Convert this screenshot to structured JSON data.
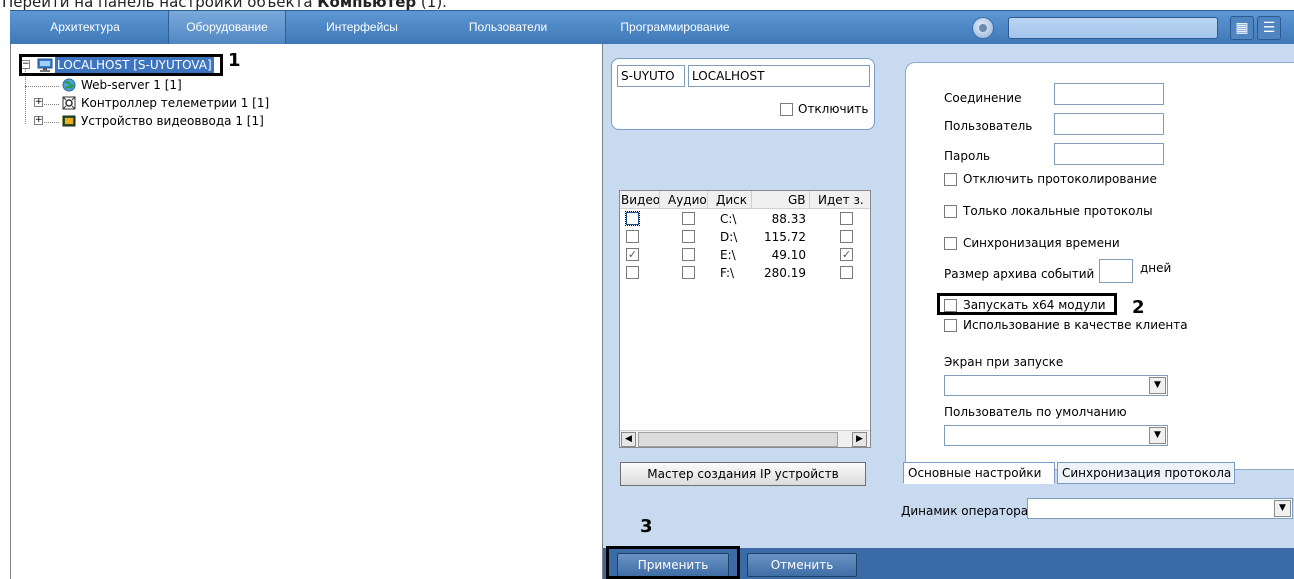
{
  "caption": {
    "text_prefix": "Перейти на панель настройки объекта ",
    "text_bold": "Компьютер",
    "text_suffix": " (1)."
  },
  "menubar": {
    "items": [
      "Архитектура",
      "Оборудование",
      "Интерфейсы",
      "Пользователи",
      "Программирование"
    ],
    "active_index": 1,
    "search_value": "",
    "icons": [
      "search-icon",
      "grid-view-icon",
      "list-view-icon"
    ]
  },
  "tree": {
    "root_label": "LOCALHOST [S-UYUTOVA]",
    "children": [
      {
        "label": "Web-server 1 [1]",
        "icon": "globe-icon"
      },
      {
        "label": "Контроллер телеметрии 1 [1]",
        "icon": "telemetry-icon"
      },
      {
        "label": "Устройство видеоввода 1 [1]",
        "icon": "video-card-icon"
      }
    ]
  },
  "callouts": {
    "one": "1",
    "two": "2",
    "three": "3"
  },
  "host": {
    "id_value": "S-UYUTO",
    "name_value": "LOCALHOST",
    "disable_label": "Отключить"
  },
  "disk_grid": {
    "headers": [
      "Видео",
      "Аудио",
      "Диск",
      "GB",
      "Идет з."
    ],
    "rows": [
      {
        "video": false,
        "audio": false,
        "disk": "C:\\",
        "gb": "88.33",
        "rec": false
      },
      {
        "video": false,
        "audio": false,
        "disk": "D:\\",
        "gb": "115.72",
        "rec": false
      },
      {
        "video": true,
        "audio": false,
        "disk": "E:\\",
        "gb": "49.10",
        "rec": true
      },
      {
        "video": false,
        "audio": false,
        "disk": "F:\\",
        "gb": "280.19",
        "rec": false
      }
    ]
  },
  "wizard_button": "Мастер создания IP устройств",
  "settings": {
    "connection_label": "Соединение",
    "connection_value": "",
    "user_label": "Пользователь",
    "user_value": "",
    "password_label": "Пароль",
    "password_value": "",
    "disable_logging": "Отключить протоколирование",
    "local_logs_only": "Только локальные протоколы",
    "time_sync": "Синхронизация времени",
    "archive_size_label": "Размер архива событий",
    "archive_size_value": "",
    "archive_size_unit": "дней",
    "x64_modules": "Запускать x64 модули",
    "use_as_client": "Использование в качестве клиента",
    "startup_screen_label": "Экран при запуске",
    "startup_screen_value": "",
    "default_user_label": "Пользователь по умолчанию",
    "default_user_value": ""
  },
  "tabs": [
    "Основные настройки",
    "Синхронизация протокола"
  ],
  "speaker": {
    "label": "Динамик оператора:",
    "value": ""
  },
  "bottom": {
    "apply": "Применить",
    "cancel": "Отменить"
  }
}
